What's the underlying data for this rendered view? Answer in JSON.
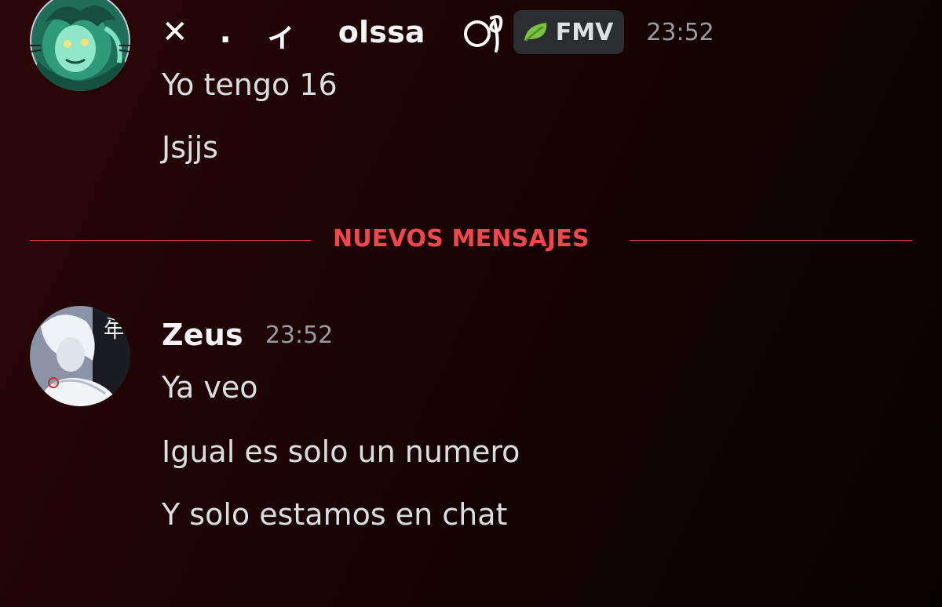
{
  "messages": [
    {
      "author": {
        "display_decor": [
          "✕",
          ".",
          "ィ"
        ],
        "name": "olssa",
        "name_suffix_icon": "circle-curl-icon",
        "guild_tag": {
          "icon": "leaf-icon",
          "label": "FMV",
          "color": "#7cc242"
        }
      },
      "timestamp": "23:52",
      "avatar": {
        "name": "green-character-avatar",
        "colors": [
          "#2a8a6a",
          "#7ee0c0",
          "#c9c3d8"
        ]
      },
      "lines": [
        "Yo tengo 16",
        "Jsjjs"
      ]
    },
    {
      "author": {
        "name": "Zeus"
      },
      "timestamp": "23:52",
      "avatar": {
        "name": "white-hair-character-avatar",
        "colors": [
          "#e9ecf2",
          "#9aa3b5",
          "#1a1a22"
        ]
      },
      "lines": [
        "Ya veo",
        "Igual es solo un numero",
        "Y solo estamos en chat"
      ]
    }
  ],
  "divider": {
    "label": "NUEVOS MENSAJES",
    "color": "#f0474d"
  }
}
